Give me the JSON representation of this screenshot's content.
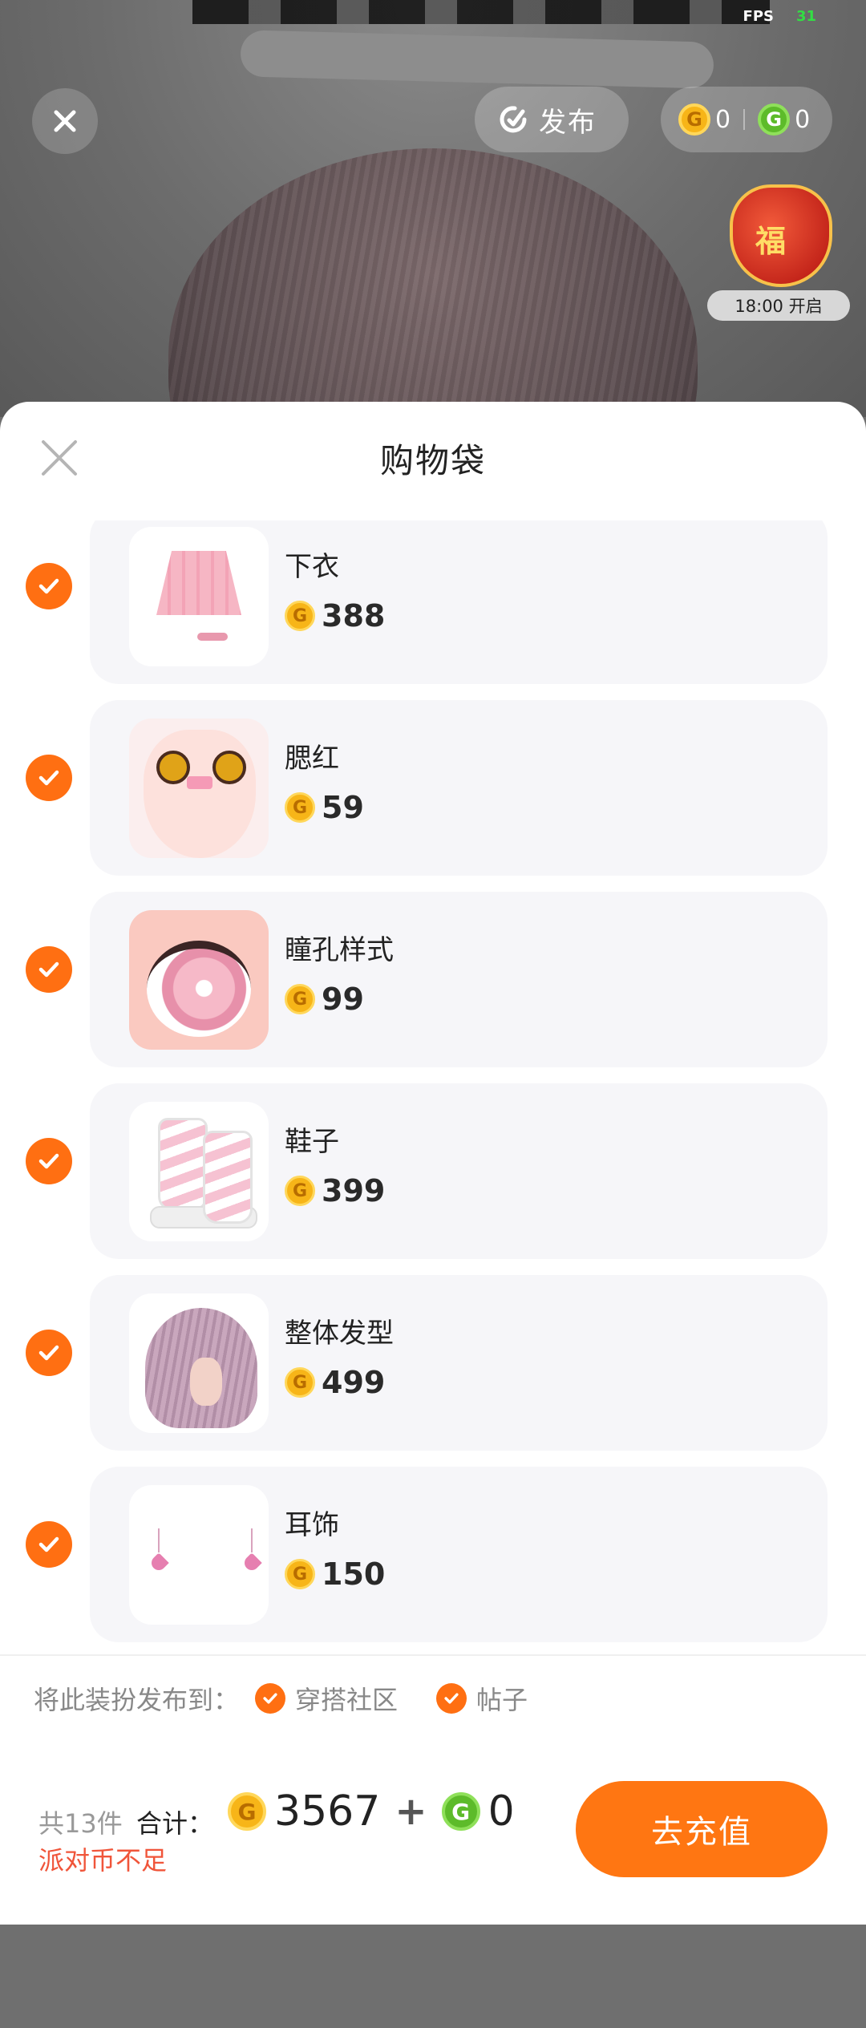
{
  "hud": {
    "fps_label": "FPS",
    "fps_value": "31",
    "publish_label": "发布",
    "gold_balance": "0",
    "green_balance": "0",
    "event_timer": "18:00 开启",
    "event_char": "福"
  },
  "sheet": {
    "title": "购物袋",
    "items": [
      {
        "name": "下衣",
        "price": "388",
        "checked": true,
        "icon": "skirt-thumbnail"
      },
      {
        "name": "腮红",
        "price": "59",
        "checked": true,
        "icon": "blush-thumbnail"
      },
      {
        "name": "瞳孔样式",
        "price": "99",
        "checked": true,
        "icon": "pupil-thumbnail"
      },
      {
        "name": "鞋子",
        "price": "399",
        "checked": true,
        "icon": "shoes-thumbnail"
      },
      {
        "name": "整体发型",
        "price": "499",
        "checked": true,
        "icon": "hairstyle-thumbnail"
      },
      {
        "name": "耳饰",
        "price": "150",
        "checked": true,
        "icon": "earring-thumbnail"
      }
    ]
  },
  "share": {
    "label": "将此装扮发布到：",
    "option1": "穿搭社区",
    "option2": "帖子"
  },
  "footer": {
    "count": "共13件",
    "total_label": "合计：",
    "gold_total": "3567",
    "plus": "+",
    "green_total": "0",
    "warning": "派对币不足",
    "recharge_label": "去充值"
  },
  "colors": {
    "accent": "#ff7612",
    "check": "#ff6f12",
    "warning": "#f0553a",
    "gold_coin": "#f7b518",
    "green_coin": "#5dbb2a"
  }
}
